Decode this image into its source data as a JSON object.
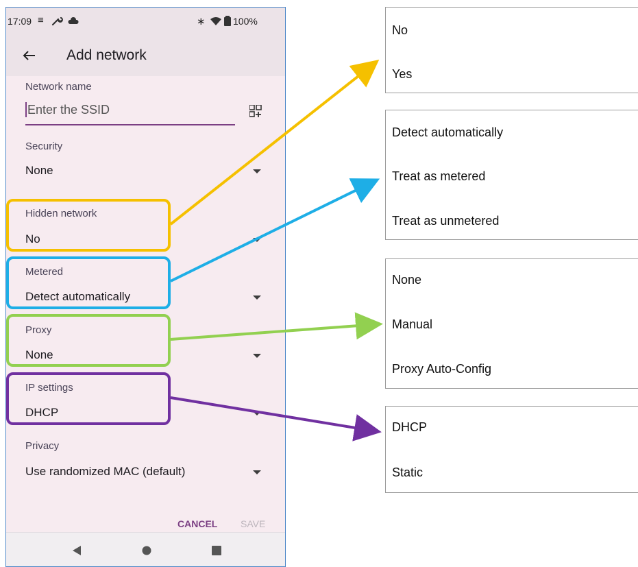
{
  "status_bar": {
    "time": "17:09",
    "battery": "100%"
  },
  "app_bar": {
    "title": "Add network",
    "back_icon": "arrow-back-icon"
  },
  "form": {
    "network_name_label": "Network name",
    "ssid_placeholder": "Enter the SSID",
    "security_label": "Security",
    "security_value": "None",
    "hidden_label": "Hidden network",
    "hidden_value": "No",
    "metered_label": "Metered",
    "metered_value": "Detect automatically",
    "proxy_label": "Proxy",
    "proxy_value": "None",
    "ip_label": "IP settings",
    "ip_value": "DHCP",
    "privacy_label": "Privacy",
    "privacy_value": "Use randomized MAC (default)"
  },
  "actions": {
    "cancel": "CANCEL",
    "save": "SAVE"
  },
  "panels": {
    "hidden": [
      "No",
      "Yes"
    ],
    "metered": [
      "Detect automatically",
      "Treat as metered",
      "Treat as unmetered"
    ],
    "proxy": [
      "None",
      "Manual",
      "Proxy Auto-Config"
    ],
    "ip": [
      "DHCP",
      "Static"
    ]
  },
  "colors": {
    "hidden": "#f5c000",
    "metered": "#1eaee6",
    "proxy": "#92d050",
    "ip": "#7030a0",
    "accent": "#7b3f83"
  }
}
